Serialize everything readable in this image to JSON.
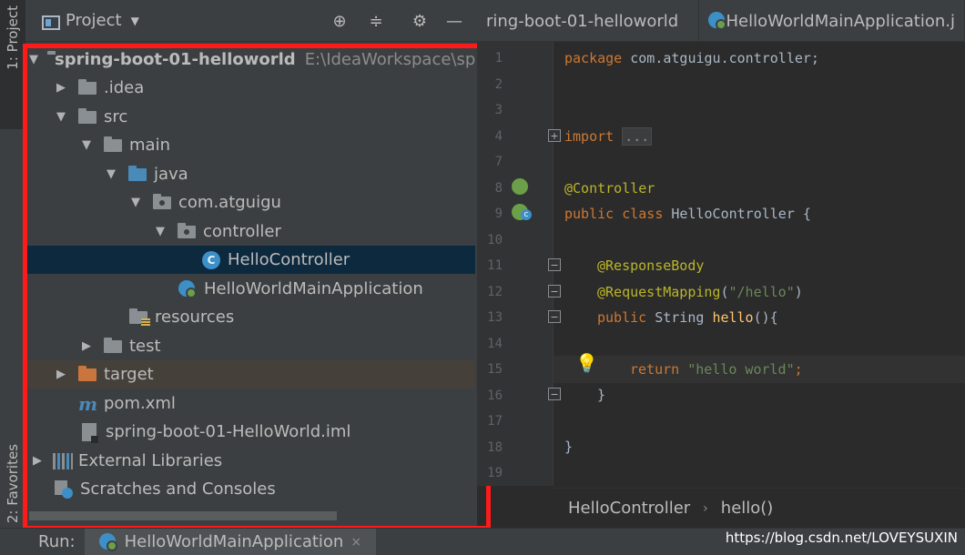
{
  "sidebar": {
    "project_tab": "1: Project",
    "favorites_tab": "2: Favorites"
  },
  "project_panel": {
    "title": "Project",
    "tree": [
      {
        "label": "spring-boot-01-helloworld",
        "path": "E:\\IdeaWorkspace\\sp",
        "icon": "project-module-icon"
      },
      {
        "label": ".idea",
        "icon": "folder-icon"
      },
      {
        "label": "src",
        "icon": "folder-icon"
      },
      {
        "label": "main",
        "icon": "folder-icon"
      },
      {
        "label": "java",
        "icon": "source-folder-icon"
      },
      {
        "label": "com.atguigu",
        "icon": "package-icon"
      },
      {
        "label": "controller",
        "icon": "package-icon"
      },
      {
        "label": "HelloController",
        "icon": "class-icon",
        "selected": true
      },
      {
        "label": "HelloWorldMainApplication",
        "icon": "spring-boot-app-icon"
      },
      {
        "label": "resources",
        "icon": "resources-folder-icon"
      },
      {
        "label": "test",
        "icon": "folder-icon"
      },
      {
        "label": "target",
        "icon": "excluded-folder-icon"
      },
      {
        "label": "pom.xml",
        "icon": "maven-icon"
      },
      {
        "label": "spring-boot-01-HelloWorld.iml",
        "icon": "iml-file-icon"
      },
      {
        "label": "External Libraries",
        "icon": "libraries-icon"
      },
      {
        "label": "Scratches and Consoles",
        "icon": "scratches-icon"
      }
    ]
  },
  "editor": {
    "tabs": [
      {
        "label": "ring-boot-01-helloworld"
      },
      {
        "label": "HelloWorldMainApplication.j"
      }
    ],
    "line_numbers": [
      "1",
      "2",
      "3",
      "4",
      "7",
      "8",
      "9",
      "10",
      "11",
      "12",
      "13",
      "14",
      "15",
      "16",
      "17",
      "18",
      "19"
    ],
    "code": {
      "l1_kw": "package",
      "l1_rest": " com.atguigu.controller;",
      "l4_kw": "import",
      "l4_fold": "...",
      "l8_ann": "@Controller",
      "l9_kw1": "public",
      "l9_kw2": "class",
      "l9_rest": " HelloController {",
      "l11_ann": "@ResponseBody",
      "l12_ann": "@RequestMapping",
      "l12_open": "(",
      "l12_str": "\"/hello\"",
      "l12_close": ")",
      "l13_kw": "public",
      "l13_type": " String ",
      "l13_fn": "hello",
      "l13_rest": "(){",
      "l15_kw": "return",
      "l15_str": "\"hello world\"",
      "l15_end": ";",
      "l16": "}",
      "l18": "}"
    },
    "breadcrumb": [
      "HelloController",
      "hello()"
    ]
  },
  "run_bar": {
    "label": "Run:",
    "tab": "HelloWorldMainApplication",
    "close": "×"
  },
  "watermark": "https://blog.csdn.net/LOVEYSUXIN",
  "colors": {
    "annotation_frame": "#ff1a1a",
    "selection": "#0d293e",
    "keyword": "#cc7832",
    "annotation": "#bbb529",
    "string": "#6a8759"
  }
}
